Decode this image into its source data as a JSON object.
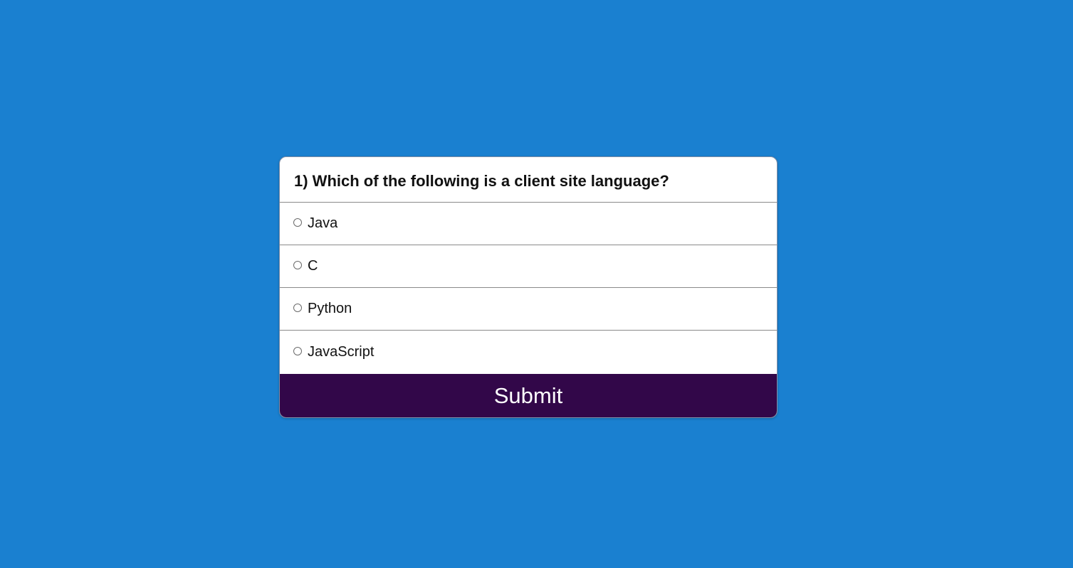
{
  "quiz": {
    "question": "1) Which of the following is a client site language?",
    "options": [
      {
        "label": "Java",
        "selected": false
      },
      {
        "label": "C",
        "selected": false
      },
      {
        "label": "Python",
        "selected": false
      },
      {
        "label": "JavaScript",
        "selected": false
      }
    ],
    "submit_label": "Submit"
  },
  "colors": {
    "page_background": "#1a80d0",
    "card_background": "#ffffff",
    "submit_background": "#320749",
    "submit_text": "#ffffff"
  }
}
